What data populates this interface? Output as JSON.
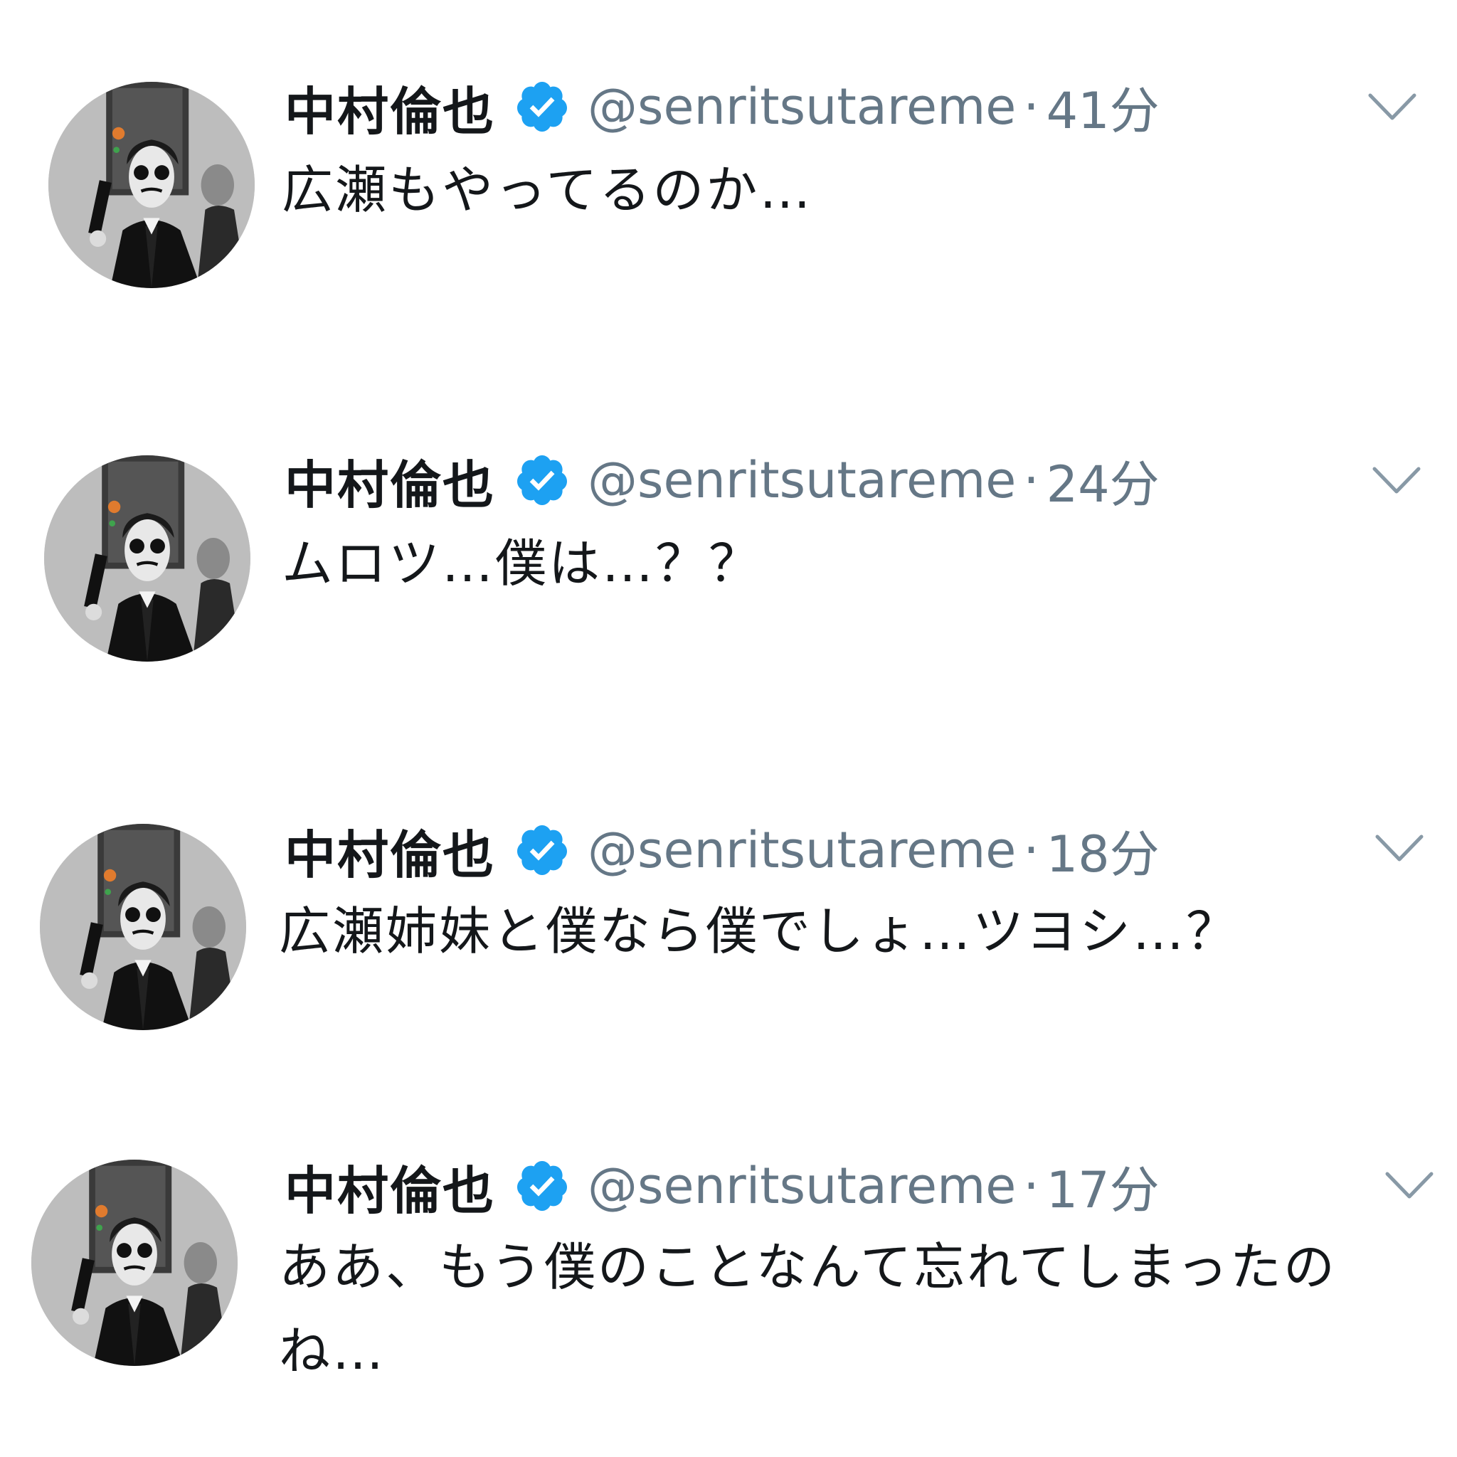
{
  "tweets": [
    {
      "name": "中村倫也",
      "handle": "@senritsutareme",
      "separator": "·",
      "time": "41分",
      "text": "広瀬もやってるのか…",
      "avatar_icon": "profile-photo",
      "menu_icon": "chevron-down-icon"
    },
    {
      "name": "中村倫也",
      "handle": "@senritsutareme",
      "separator": "·",
      "time": "24分",
      "text": "ムロツ…僕は…？？",
      "avatar_icon": "profile-photo",
      "menu_icon": "chevron-down-icon"
    },
    {
      "name": "中村倫也",
      "handle": "@senritsutareme",
      "separator": "·",
      "time": "18分",
      "text": "広瀬姉妹と僕なら僕でしょ…ツヨシ…？",
      "avatar_icon": "profile-photo",
      "menu_icon": "chevron-down-icon"
    },
    {
      "name": "中村倫也",
      "handle": "@senritsutareme",
      "separator": "·",
      "time": "17分",
      "text": "ああ、もう僕のことなんて忘れてしまったのね…",
      "avatar_icon": "profile-photo",
      "menu_icon": "chevron-down-icon"
    }
  ],
  "colors": {
    "name": "#14171a",
    "meta": "#657786",
    "verified": "#1da1f2",
    "caret": "#8899a6"
  }
}
